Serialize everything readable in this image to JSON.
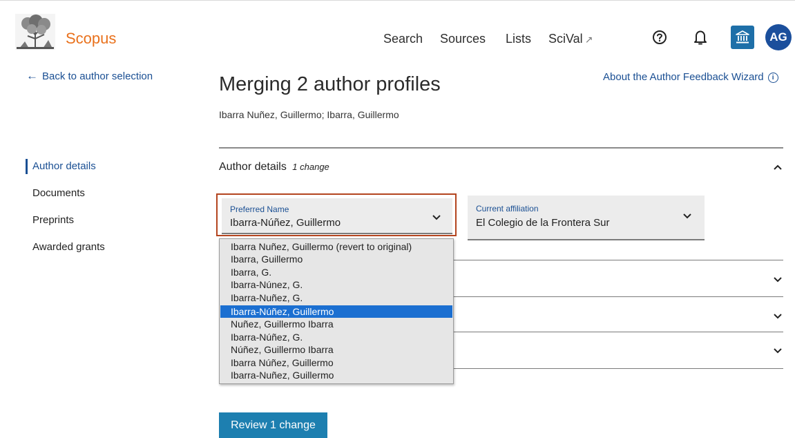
{
  "header": {
    "brand": "Scopus",
    "nav": [
      {
        "label": "Search"
      },
      {
        "label": "Sources"
      },
      {
        "label": "Lists"
      },
      {
        "label": "SciVal",
        "icon": "external-link-icon"
      }
    ],
    "avatar_initials": "AG",
    "brand_color": "#e9711c",
    "icons": [
      "help-icon",
      "bell-icon",
      "institution-icon"
    ]
  },
  "back_link": "Back to author selection",
  "sidebar": {
    "items": [
      {
        "label": "Author details",
        "active": true
      },
      {
        "label": "Documents"
      },
      {
        "label": "Preprints"
      },
      {
        "label": "Awarded grants"
      }
    ]
  },
  "main": {
    "title": "Merging 2 author profiles",
    "subtitle": "Ibarra Nuñez, Guillermo; Ibarra, Guillermo",
    "about_link": "About the Author Feedback Wizard",
    "section": {
      "title": "Author details",
      "change_note": "1 change"
    },
    "preferred_name": {
      "label": "Preferred Name",
      "value": "Ibarra-Núñez, Guillermo",
      "options": [
        "Ibarra Nuñez, Guillermo (revert to original)",
        "Ibarra, Guillermo",
        "Ibarra, G.",
        "Ibarra-Núnez, G.",
        "Ibarra-Nuñez, G.",
        "Ibarra-Núñez, Guillermo",
        "Nuñez, Guillermo Ibarra",
        "Ibarra-Núñez, G.",
        "Núñez, Guillermo Ibarra",
        "Ibarra Núñez, Guillermo",
        "Ibarra-Nuñez, Guillermo"
      ],
      "selected_index": 5
    },
    "current_affiliation": {
      "label": "Current affiliation",
      "value": "El Colegio de la Frontera Sur"
    },
    "review_button": "Review 1 change"
  },
  "colors": {
    "link": "#1a4f93",
    "primary_button": "#1d7fb0",
    "focus_outline": "#b3441e",
    "selected_option": "#1b6fd1"
  }
}
